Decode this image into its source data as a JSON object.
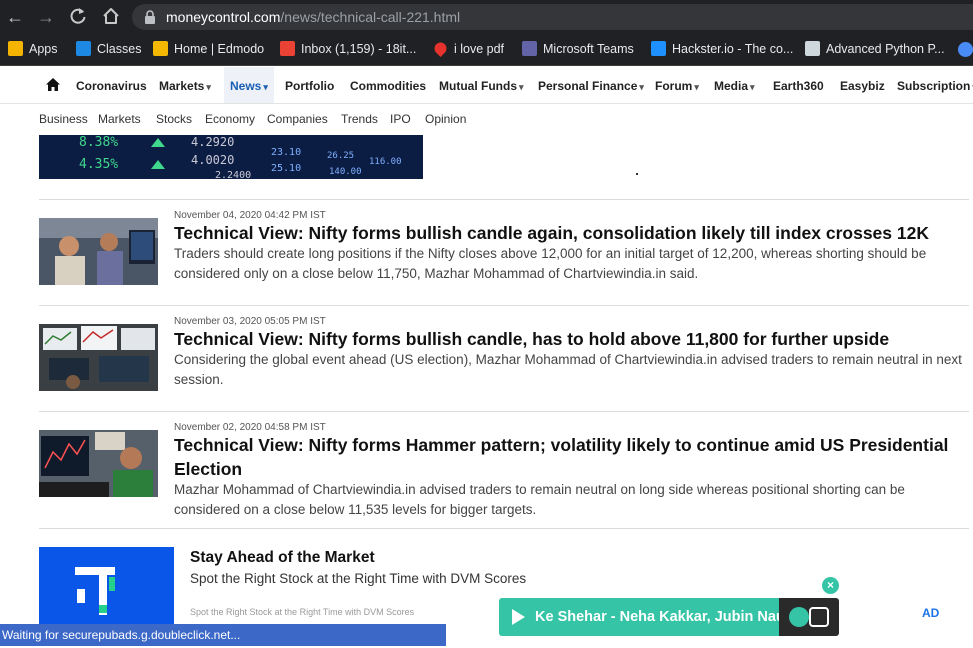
{
  "browser": {
    "url_host": "moneycontrol.com",
    "url_path": "/news/technical-call-221.html",
    "bookmarks": [
      {
        "label": "Apps",
        "icon": "apps-grid-icon",
        "color": "#f4b400"
      },
      {
        "label": "Classes",
        "icon": "google-classroom-icon",
        "color": "#1e88e5"
      },
      {
        "label": "Home | Edmodo",
        "icon": "edmodo-icon",
        "color": "#f5b800"
      },
      {
        "label": "Inbox (1,159) - 18it...",
        "icon": "gmail-icon",
        "color": "#ea4335"
      },
      {
        "label": "i love pdf",
        "icon": "heart-icon",
        "color": "#e5322d"
      },
      {
        "label": "Microsoft Teams",
        "icon": "teams-icon",
        "color": "#6264a7"
      },
      {
        "label": "Hackster.io - The co...",
        "icon": "hackster-icon",
        "color": "#1e90ff"
      },
      {
        "label": "Advanced Python P...",
        "icon": "python-site-icon",
        "color": "#cfd8dc"
      }
    ]
  },
  "nav": {
    "home_icon": "home-icon",
    "items": [
      {
        "label": "Coronavirus",
        "dropdown": false
      },
      {
        "label": "Markets",
        "dropdown": true
      },
      {
        "label": "News",
        "dropdown": true,
        "active": true
      },
      {
        "label": "Portfolio",
        "dropdown": false
      },
      {
        "label": "Commodities",
        "dropdown": false
      },
      {
        "label": "Mutual Funds",
        "dropdown": true
      },
      {
        "label": "Personal Finance",
        "dropdown": true
      },
      {
        "label": "Forum",
        "dropdown": true
      },
      {
        "label": "Media",
        "dropdown": true
      },
      {
        "label": "Earth360",
        "dropdown": false
      },
      {
        "label": "Easybiz",
        "dropdown": false
      },
      {
        "label": "Subscription",
        "dropdown": true
      }
    ],
    "sub_items": [
      "Business",
      "Markets",
      "Stocks",
      "Economy",
      "Companies",
      "Trends",
      "IPO",
      "Opinion"
    ]
  },
  "hero": {
    "tickers": [
      "8.38%",
      "4.2920",
      "4.35%",
      "4.0020",
      "23.10",
      "25.10",
      "26.25",
      "116.00",
      "140.00",
      "2.2400"
    ]
  },
  "articles": [
    {
      "date": "November 04, 2020 04:42 PM IST",
      "title": "Technical View: Nifty forms bullish candle again, consolidation likely till index crosses 12K",
      "summary": "Traders should create long positions if the Nifty closes above 12,000 for an initial target of 12,200, whereas shorting should be considered only on a close below 11,750, Mazhar Mohammad of Chartviewindia.in said."
    },
    {
      "date": "November 03, 2020 05:05 PM IST",
      "title": "Technical View: Nifty forms bullish candle, has to hold above 11,800 for further upside",
      "summary": "Considering the global event ahead (US election), Mazhar Mohammad of Chartviewindia.in advised traders to remain neutral in next session."
    },
    {
      "date": "November 02, 2020 04:58 PM IST",
      "title": "Technical View: Nifty forms Hammer pattern; volatility likely to continue amid US Presidential Election",
      "summary": "Mazhar Mohammad of Chartviewindia.in advised traders to remain neutral on long side whereas positional shorting can be considered on a close below 11,535 levels for bigger targets."
    }
  ],
  "ad": {
    "title": "Stay Ahead of the Market",
    "description": "Spot the Right Stock at the Right Time with DVM Scores",
    "small_text": "Spot the Right Stock at the Right Time with DVM Scores",
    "badge": "AD"
  },
  "player": {
    "song": "Ke Shehar - Neha Kakkar, Jubin Nautiyal"
  },
  "status": {
    "text": "Waiting for securepubads.g.doubleclick.net..."
  }
}
